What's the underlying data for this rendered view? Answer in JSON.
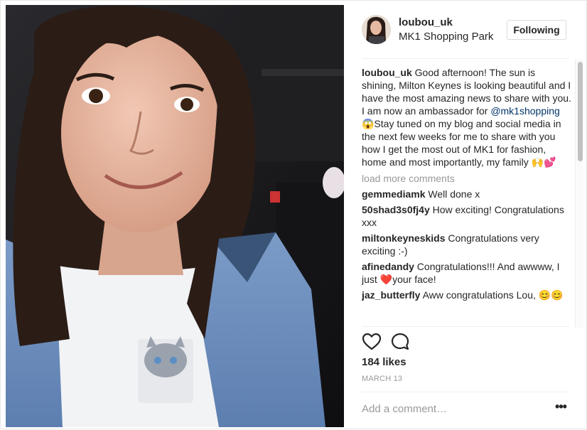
{
  "post": {
    "username": "loubou_uk",
    "location": "MK1 Shopping Park",
    "follow_label": "Following",
    "caption": {
      "username": "loubou_uk",
      "text_before": " Good afternoon! The sun is shining, Milton Keynes is looking beautiful and I have the most amazing news to share with you. I am now an ambassador for ",
      "mention": "@mk1shopping",
      "emoji_1": "😱",
      "text_after": "Stay tuned on my blog and social media in the next few weeks for me to share with you how I get the most out of MK1 for fashion, home and most importantly, my family ",
      "emoji_2": "🙌💕"
    },
    "load_more": "load more comments",
    "comments": [
      {
        "user": "gemmediamk",
        "text": " Well done x"
      },
      {
        "user": "50shad3s0fj4y",
        "text": " How exciting! Congratulations xxx"
      },
      {
        "user": "miltonkeyneskids",
        "text": " Congratulations very exciting :-)"
      },
      {
        "user": "afinedandy",
        "text_before": " Congratulations!!! And awwww, I just ",
        "emoji": "❤️",
        "text_after": "your face!"
      },
      {
        "user": "jaz_butterfly",
        "text": " Aww congratulations Lou, ",
        "emoji": "😊😊"
      }
    ],
    "likes": "184 likes",
    "date": "MARCH 13",
    "comment_placeholder": "Add a comment…",
    "more_label": "•••",
    "icons": {
      "like": "heart-outline-icon",
      "comment": "speech-bubble-icon",
      "more": "ellipsis-icon"
    },
    "colors": {
      "text": "#262626",
      "muted": "#999999",
      "mention": "#003569",
      "border": "#dbdbdb"
    }
  }
}
